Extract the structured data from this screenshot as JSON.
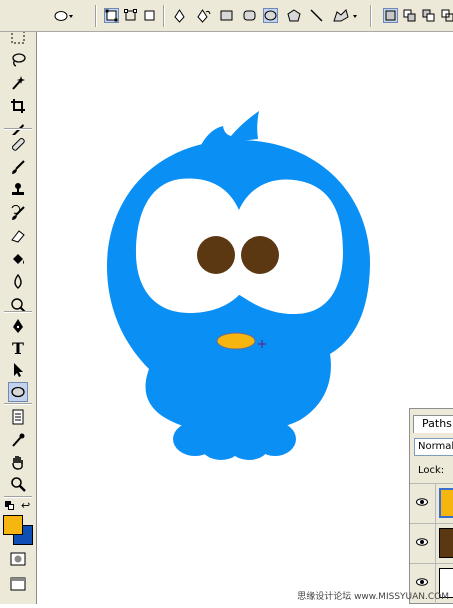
{
  "colors": {
    "bird_body": "#0a8ff5",
    "eye_white": "#ffffff",
    "pupil": "#5b3812",
    "beak": "#f7b50f",
    "foreground_swatch": "#f7b50f",
    "background_swatch": "#0d4fb4",
    "ui_bg": "#ece9d8"
  },
  "options_bar": {
    "icons": [
      "ellipse-preset-icon",
      "shape-layers-icon",
      "paths-icon",
      "fill-pixels-icon",
      "pen-icon",
      "freeform-pen-icon",
      "rectangle-icon",
      "rounded-rectangle-icon",
      "ellipse-icon",
      "polygon-icon",
      "line-icon",
      "custom-shape-icon",
      "new-layer-icon",
      "add-area-icon",
      "subtract-area-icon"
    ]
  },
  "toolbar": {
    "type_tool_label": "T",
    "tools": [
      "move",
      "marquee",
      "lasso",
      "magic-wand",
      "crop",
      "slice",
      "healing",
      "brush",
      "clone-stamp",
      "history-brush",
      "eraser",
      "paint-bucket",
      "blur",
      "dodge",
      "pen",
      "type",
      "path-selection",
      "ellipse",
      "notes",
      "eyedropper",
      "hand",
      "zoom"
    ]
  },
  "layers_panel": {
    "tab_label": "Paths",
    "blend_mode": "Normal",
    "lock_label": "Lock:",
    "layer_colors": [
      "#f7b50f",
      "#5b3812",
      "#ffffff"
    ]
  },
  "watermark": "思缘设计论坛  www.MISSYUAN.COM"
}
